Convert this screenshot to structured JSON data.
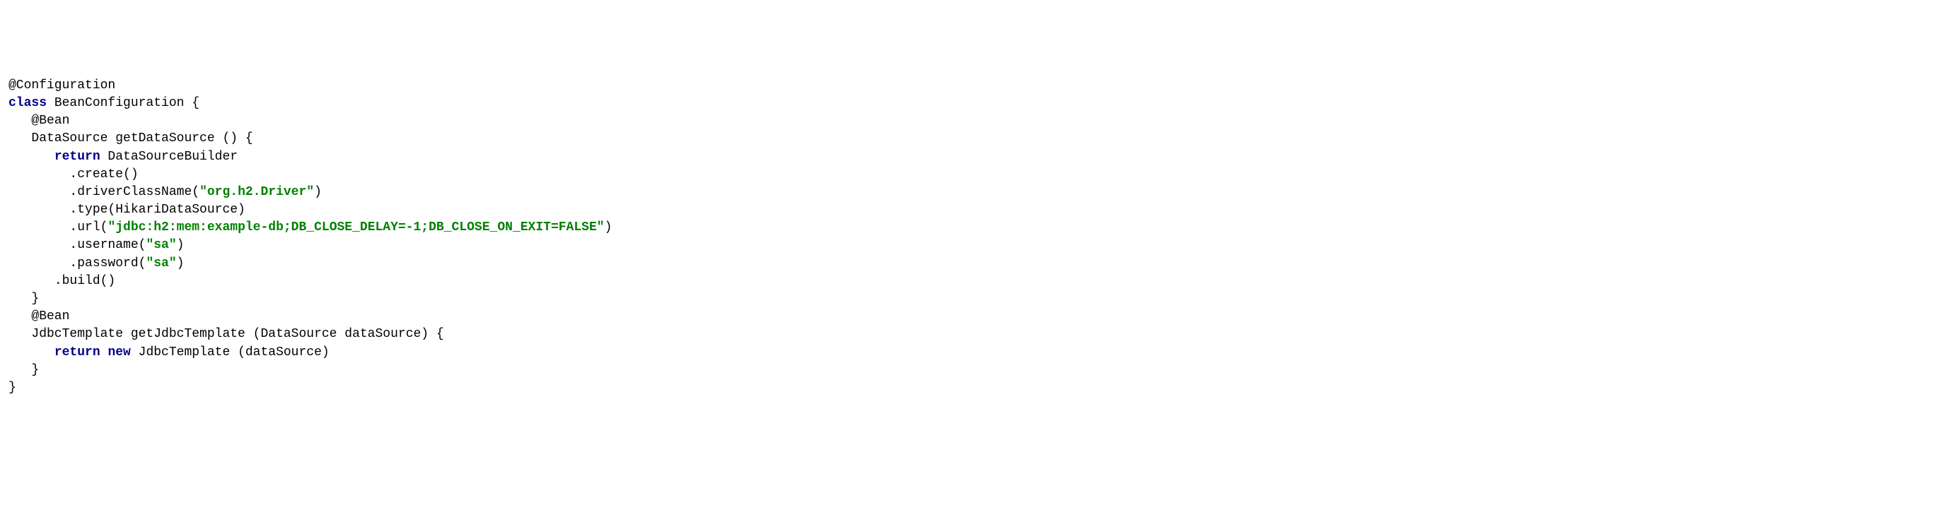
{
  "code": {
    "line1": {
      "annotation": "@Configuration"
    },
    "line2": {
      "keyword": "class",
      "rest": " BeanConfiguration {"
    },
    "line3": "",
    "line4": {
      "indent": "   ",
      "annotation": "@Bean"
    },
    "line5": {
      "indent": "   ",
      "text": "DataSource getDataSource () {"
    },
    "line6": "",
    "line7": {
      "indent": "      ",
      "keyword": "return",
      "rest": " DataSourceBuilder"
    },
    "line8": {
      "indent": "        ",
      "text": ".create()"
    },
    "line9": {
      "indent": "        ",
      "prefix": ".driverClassName(",
      "string": "\"org.h2.Driver\"",
      "suffix": ")"
    },
    "line10": {
      "indent": "        ",
      "text": ".type(HikariDataSource)"
    },
    "line11": {
      "indent": "        ",
      "prefix": ".url(",
      "string": "\"jdbc:h2:mem:example-db;DB_CLOSE_DELAY=-1;DB_CLOSE_ON_EXIT=FALSE\"",
      "suffix": ")"
    },
    "line12": {
      "indent": "        ",
      "prefix": ".username(",
      "string": "\"sa\"",
      "suffix": ")"
    },
    "line13": {
      "indent": "        ",
      "prefix": ".password(",
      "string": "\"sa\"",
      "suffix": ")"
    },
    "line14": {
      "indent": "      ",
      "text": ".build()"
    },
    "line15": {
      "indent": "   ",
      "text": "}"
    },
    "line16": "",
    "line17": {
      "indent": "   ",
      "annotation": "@Bean"
    },
    "line18": {
      "indent": "   ",
      "text": "JdbcTemplate getJdbcTemplate (DataSource dataSource) {"
    },
    "line19": {
      "indent": "      ",
      "keyword1": "return",
      "space": " ",
      "keyword2": "new",
      "rest": " JdbcTemplate (dataSource)"
    },
    "line20": {
      "indent": "   ",
      "text": "}"
    },
    "line21": {
      "text": "}"
    }
  }
}
